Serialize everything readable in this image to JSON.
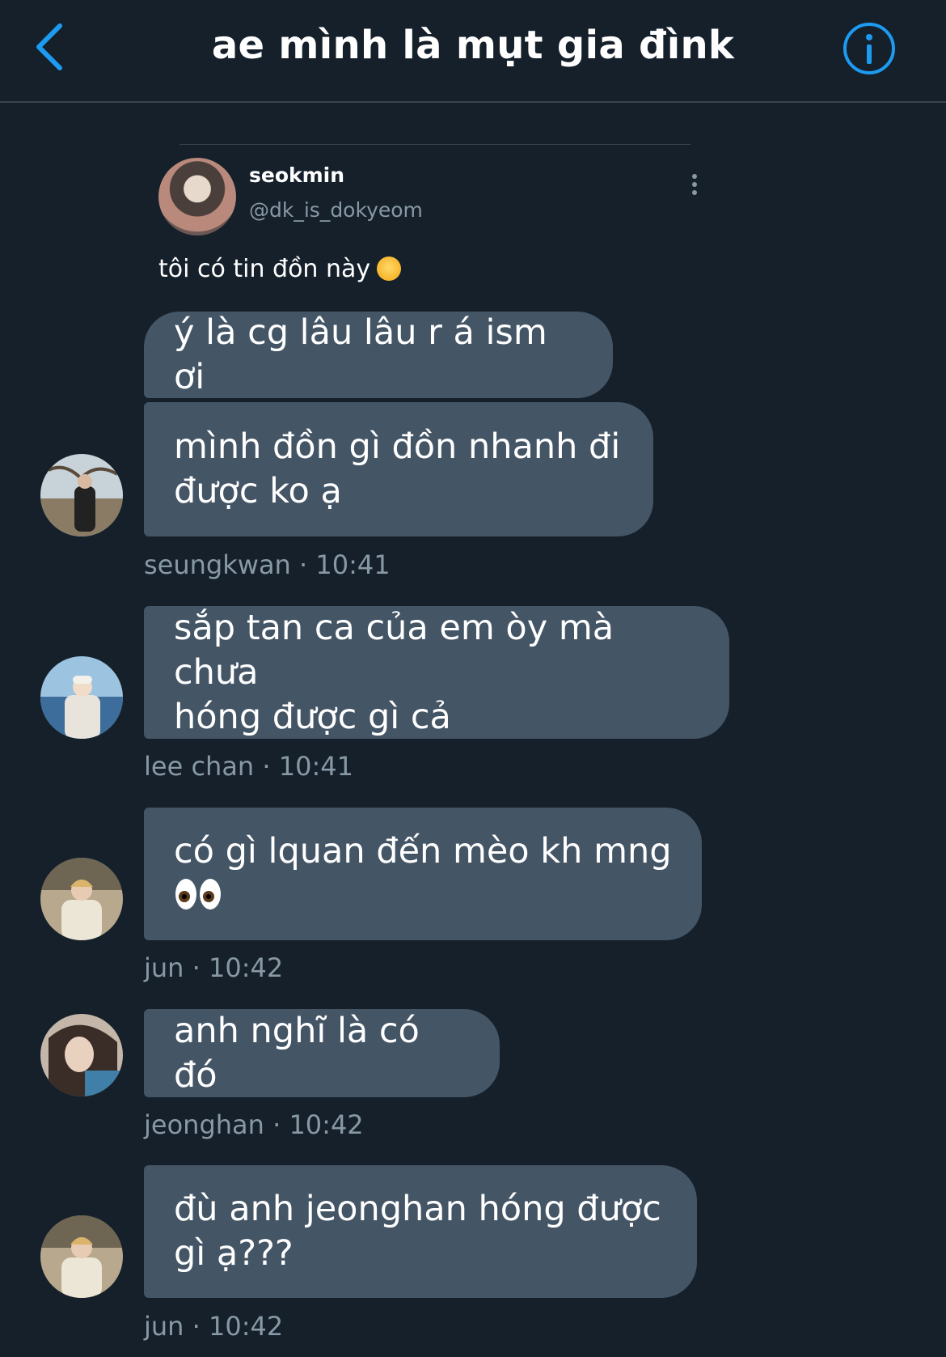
{
  "header": {
    "title": "ae mình là mụt gia đìnk"
  },
  "tweet": {
    "name": "seokmin",
    "handle": "@dk_is_dokyeom",
    "text": "tôi có tin đồn này"
  },
  "messages": [
    {
      "lines": [
        "ý là cg lâu lâu r á ism ơi"
      ]
    },
    {
      "lines": [
        "mình đồn gì đồn nhanh đi",
        "được ko ạ"
      ]
    },
    {
      "lines": [
        "sắp tan ca của em òy mà chưa",
        "hóng được gì cả"
      ]
    },
    {
      "lines": [
        "có gì lquan đến mèo kh mng",
        ""
      ]
    },
    {
      "lines": [
        "anh nghĩ là có đó"
      ]
    },
    {
      "lines": [
        "đù anh jeonghan hóng được",
        "gì ạ???"
      ]
    }
  ],
  "meta": [
    "seungkwan · 10:41",
    "lee chan · 10:41",
    "jun · 10:42",
    "jeonghan · 10:42",
    "jun · 10:42"
  ],
  "colors": {
    "background": "#15202b",
    "bubble": "#445566",
    "accent": "#1d9bf0",
    "muted": "#8899a6"
  },
  "icons": {
    "back": "chevron-left-icon",
    "info": "info-icon",
    "more": "more-vertical-icon"
  }
}
